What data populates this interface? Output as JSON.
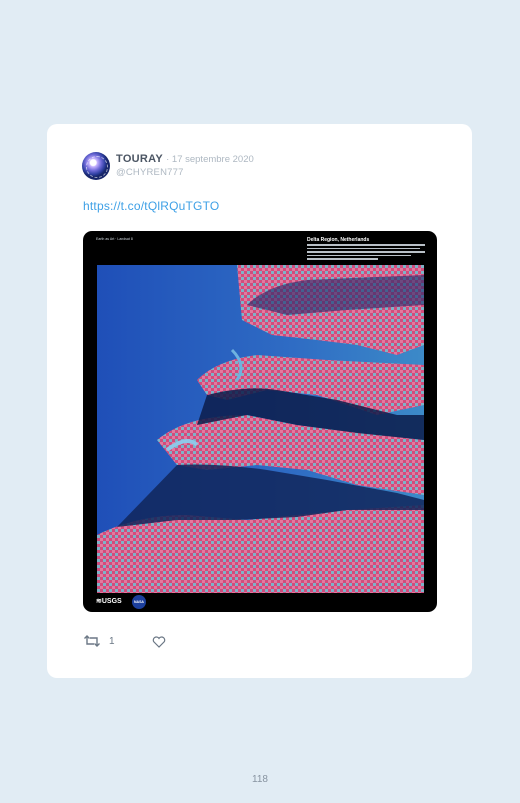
{
  "tweet": {
    "author_name": "TOURAY",
    "date": "· 17 septembre 2020",
    "handle": "@CHYREN777",
    "link_text": "https://t.co/tQlRQuTGTO",
    "retweet_count": "1",
    "media": {
      "top_left_caption": "Earth as Art · Landsat 8",
      "title": "Delta Region, Netherlands",
      "logo_usgs": "≋USGS",
      "logo_nasa": "NASA"
    }
  },
  "page": {
    "number": "118"
  },
  "colors": {
    "background": "#e1ecf4",
    "card": "#ffffff",
    "link": "#3ea0e6",
    "muted": "#aeb8c2"
  },
  "icons": [
    "retweet-icon",
    "heart-icon",
    "avatar"
  ]
}
